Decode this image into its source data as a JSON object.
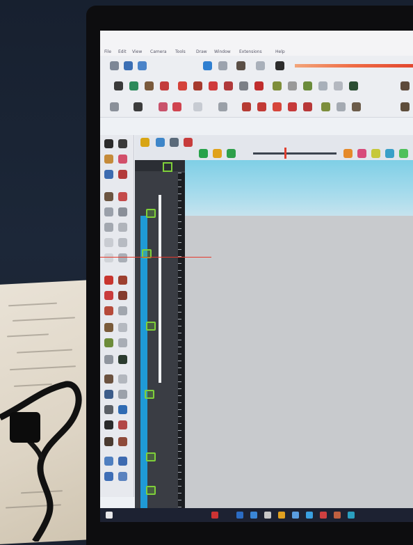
{
  "scene": {
    "description_visible_text": "",
    "screen": {
      "title_bar": {
        "text": ""
      },
      "menu_items": [
        "File",
        "Edit",
        "View",
        "Camera",
        "Tools",
        "Draw",
        "Window",
        "Extensions",
        "Help"
      ],
      "taskbar": {
        "search_text": ""
      }
    }
  }
}
